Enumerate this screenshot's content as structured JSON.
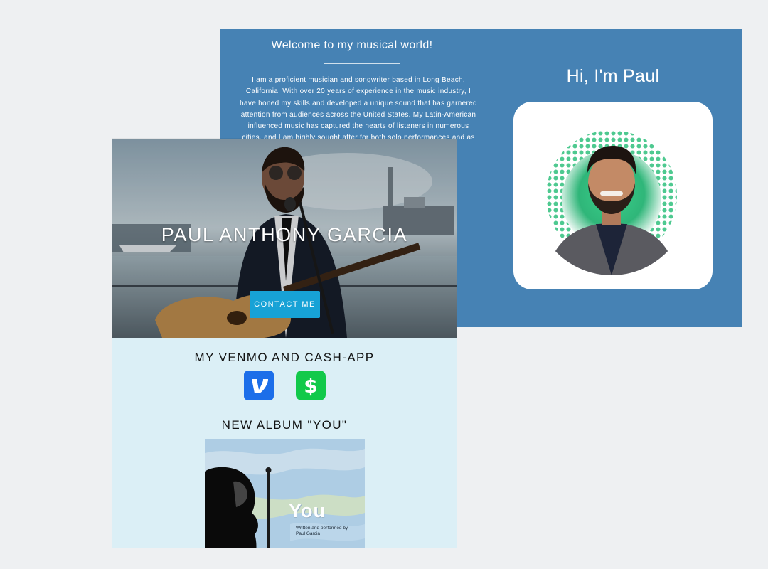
{
  "about": {
    "welcome_title": "Welcome to my musical world!",
    "bio_lines": [
      "I am a proficient musician and songwriter based in Long Beach,",
      "California. With over 20 years of experience in the music industry, I",
      "have honed my skills and developed a unique sound that has garnered",
      "attention from audiences across the United States. My Latin-American",
      "influenced music has captured the hearts of listeners in numerous",
      "cities, and I am highly sought after for both solo performances and as"
    ],
    "greeting": "Hi, I'm Paul"
  },
  "hero": {
    "name": "PAUL ANTHONY GARCIA",
    "contact_label": "CONTACT ME"
  },
  "payments": {
    "title": "MY VENMO AND CASH-APP",
    "venmo_icon": "venmo-icon",
    "cashapp_icon": "cashapp-icon",
    "venmo_color": "#1c6ee9",
    "cashapp_color": "#12c94a"
  },
  "album": {
    "title": "NEW ALBUM \"YOU\"",
    "cover_word": "You",
    "cover_credit_1": "Written and performed by",
    "cover_credit_2": "Paul Garcia"
  },
  "colors": {
    "panel_blue": "#4682b4",
    "front_bg": "#dbeff6",
    "button_blue": "#17a2d6"
  }
}
